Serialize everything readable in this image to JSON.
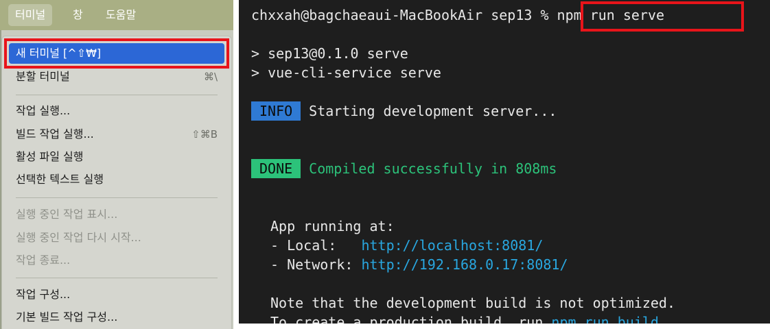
{
  "menubar": {
    "items": [
      {
        "label": "터미널"
      },
      {
        "label": "창"
      },
      {
        "label": "도움말"
      }
    ]
  },
  "menu": {
    "items": [
      {
        "label": "새 터미널 [^⇧₩]",
        "shortcut": "",
        "state": "highlighted"
      },
      {
        "label": "분할 터미널",
        "shortcut": "⌘\\",
        "state": "enabled"
      },
      {
        "label": "작업 실행...",
        "shortcut": "",
        "state": "enabled"
      },
      {
        "label": "빌드 작업 실행...",
        "shortcut": "⇧⌘B",
        "state": "enabled"
      },
      {
        "label": "활성 파일 실행",
        "shortcut": "",
        "state": "enabled"
      },
      {
        "label": "선택한 텍스트 실행",
        "shortcut": "",
        "state": "enabled"
      },
      {
        "label": "실행 중인 작업 표시...",
        "shortcut": "",
        "state": "disabled"
      },
      {
        "label": "실행 중인 작업 다시 시작...",
        "shortcut": "",
        "state": "disabled"
      },
      {
        "label": "작업 종료...",
        "shortcut": "",
        "state": "disabled"
      },
      {
        "label": "작업 구성...",
        "shortcut": "",
        "state": "enabled"
      },
      {
        "label": "기본 빌드 작업 구성...",
        "shortcut": "",
        "state": "enabled"
      }
    ]
  },
  "terminal": {
    "prompt": "chxxah@bagchaeaui-MacBookAir sep13",
    "command": "% npm run serve",
    "output": {
      "line1": "> sep13@0.1.0 serve",
      "line2": "> vue-cli-service serve",
      "info_badge": "INFO",
      "info_text": "Starting development server...",
      "done_badge": "DONE",
      "done_text": "Compiled successfully in 808ms",
      "app_running": "App running at:",
      "local_label": "- Local:   ",
      "local_url": "http://localhost:8081/",
      "network_label": "- Network: ",
      "network_url": "http://192.168.0.17:8081/",
      "note": "Note that the development build is not optimized.",
      "prod_prefix": "To create a production build, run ",
      "prod_cmd": "npm run build",
      "prod_suffix": "."
    }
  },
  "colors": {
    "menu_highlight": "#2c67d6",
    "annotation_red": "#e8141a",
    "info_badge": "#2f7ad4",
    "done_badge": "#2cc27a",
    "link": "#29a7e0",
    "terminal_bg": "#1e1e1e"
  }
}
